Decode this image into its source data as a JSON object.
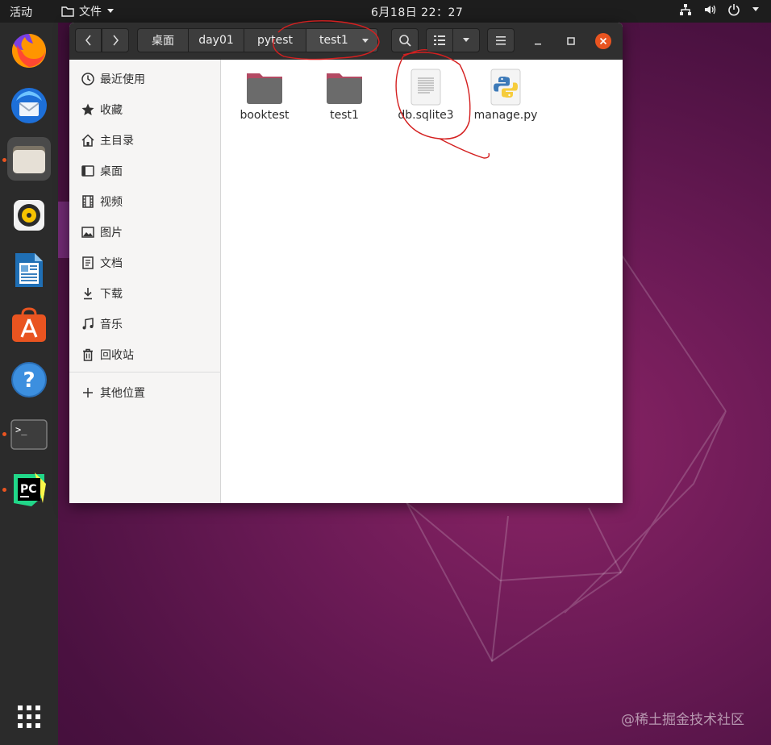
{
  "topbar": {
    "activities": "活动",
    "app_name": "文件",
    "clock": "6月18日  22：27"
  },
  "dock": {
    "items": [
      {
        "name": "firefox-icon"
      },
      {
        "name": "thunderbird-icon"
      },
      {
        "name": "files-icon"
      },
      {
        "name": "rhythmbox-icon"
      },
      {
        "name": "libreoffice-writer-icon"
      },
      {
        "name": "software-center-icon"
      },
      {
        "name": "help-icon"
      },
      {
        "name": "terminal-icon"
      },
      {
        "name": "pycharm-icon"
      }
    ],
    "terminal_prompt": ">_",
    "pycharm_label": "PC",
    "app_grid": "show-applications-icon"
  },
  "headerbar": {
    "breadcrumbs": [
      "桌面",
      "day01",
      "pytest",
      "test1"
    ]
  },
  "sidebar": {
    "items": [
      "最近使用",
      "收藏",
      "主目录",
      "桌面",
      "视频",
      "图片",
      "文档",
      "下载",
      "音乐",
      "回收站"
    ],
    "other": "其他位置"
  },
  "files": [
    {
      "name": "booktest",
      "type": "folder"
    },
    {
      "name": "test1",
      "type": "folder"
    },
    {
      "name": "db.sqlite3",
      "type": "text-file"
    },
    {
      "name": "manage.py",
      "type": "python-file"
    }
  ],
  "watermark": "@稀土掘金技术社区",
  "colors": {
    "accent": "#e95420",
    "annotation": "#d42020",
    "folder": "#6b6b6b",
    "folder_tab": "#b34a63"
  }
}
